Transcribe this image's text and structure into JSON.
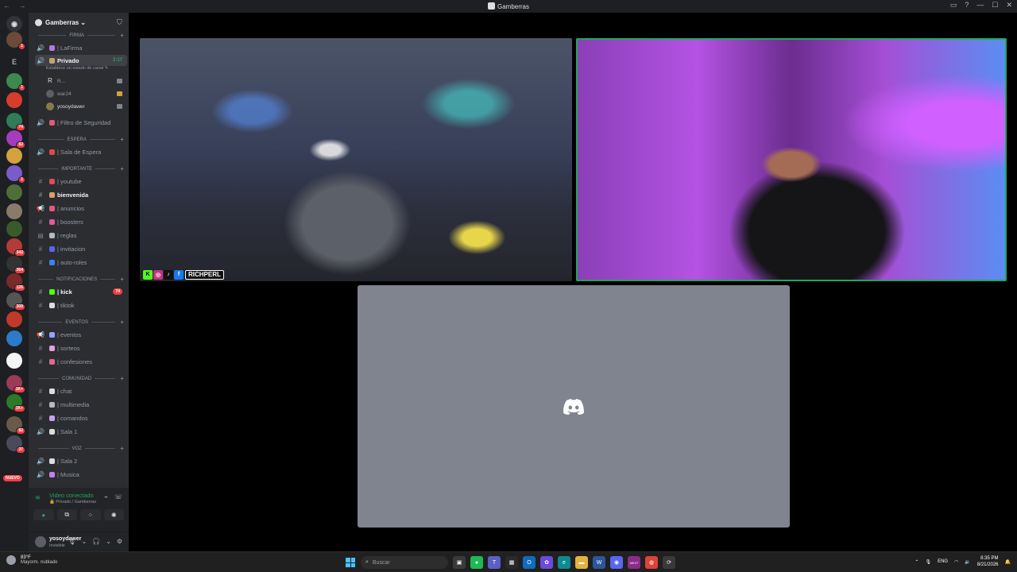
{
  "window": {
    "title": "Gamberras",
    "nav": "← →"
  },
  "window_controls": [
    "▭",
    "?",
    "—",
    "☐",
    "✕"
  ],
  "guilds": {
    "home_label": "◉",
    "letter": "E",
    "items": [
      {
        "color": "#6b4a3a",
        "badge": "1"
      },
      {
        "color": "#3c8a4f",
        "badge": "1"
      },
      {
        "color": "#d83c2e",
        "badge": ""
      },
      {
        "color": "#2f7d5a",
        "badge": "74"
      },
      {
        "color": "#a33dbd",
        "badge": "82"
      },
      {
        "color": "#d1a23e",
        "badge": ""
      },
      {
        "color": "#7a5cc8",
        "badge": "1"
      },
      {
        "color": "#4e6e3a",
        "badge": ""
      },
      {
        "color": "#8a7a6a",
        "badge": ""
      },
      {
        "color": "#3a5a2a",
        "badge": ""
      },
      {
        "color": "#b53a3a",
        "badge": "342"
      },
      {
        "color": "#333333",
        "badge": "364"
      },
      {
        "color": "#7a2a2a",
        "badge": "126"
      },
      {
        "color": "#555555",
        "badge": "309"
      },
      {
        "color": "#c0392b",
        "badge": ""
      },
      {
        "color": "#2c7ac9",
        "badge": ""
      },
      {
        "color": "#f5f5f5",
        "badge": ""
      },
      {
        "color": "#9c3a5a",
        "badge": "1K+"
      },
      {
        "color": "#2a7a2a",
        "badge": "1K+"
      },
      {
        "color": "#6a5a4a",
        "badge": "82"
      },
      {
        "color": "#4a4a5a",
        "badge": "37"
      }
    ],
    "nuevo_label": "NUEVO"
  },
  "server": {
    "name": "Gamberras",
    "chevron": "⌄"
  },
  "categories": [
    {
      "label": "FIRMA"
    },
    {
      "label": "ESPERA"
    },
    {
      "label": "IMPORTANTE"
    },
    {
      "label": "NOTIFICACIONES"
    },
    {
      "label": "EVENTOS"
    },
    {
      "label": "COMUNIDAD"
    },
    {
      "label": "VOZ"
    }
  ],
  "channels": [
    {
      "icon": "🔊",
      "label": "| LaFirma",
      "emo": "#b07ae0"
    },
    {
      "icon": "🔊",
      "label": "Privado",
      "emo": "#c9a26a",
      "timer": "2:17"
    },
    {
      "icon": "🔊",
      "label": "| Filtro de Seguridad",
      "emo": "#e05a7a"
    },
    {
      "icon": "🔊",
      "label": "| Sala de Espera",
      "emo": "#e04a4a"
    },
    {
      "icon": "#",
      "label": "| youtube",
      "emo": "#e04a5a"
    },
    {
      "icon": "#",
      "label": "bienvenida",
      "emo": "#d9a066"
    },
    {
      "icon": "📢",
      "label": "| anuncios",
      "emo": "#e05a7a"
    },
    {
      "icon": "#",
      "label": "| boosters",
      "emo": "#e05a9a"
    },
    {
      "icon": "▤",
      "label": "| reglas",
      "emo": "#b5bac1"
    },
    {
      "icon": "#",
      "label": "| invitacion",
      "emo": "#5865f2"
    },
    {
      "icon": "#",
      "label": "| auto-roles",
      "emo": "#3b82f6"
    },
    {
      "icon": "#",
      "label": "| kick",
      "emo": "#53fc18",
      "badge": "74"
    },
    {
      "icon": "#",
      "label": "| tiktok",
      "emo": "#dbdee1"
    },
    {
      "icon": "📢",
      "label": "| eventos",
      "emo": "#9aa0ff"
    },
    {
      "icon": "#",
      "label": "| sorteos",
      "emo": "#e0a0e0"
    },
    {
      "icon": "#",
      "label": "| confesiones",
      "emo": "#e06a8a"
    },
    {
      "icon": "#",
      "label": "| chat",
      "emo": "#dbdee1"
    },
    {
      "icon": "#",
      "label": "| multimedia",
      "emo": "#b5bac1"
    },
    {
      "icon": "#",
      "label": "| comandos",
      "emo": "#c8a0f0"
    },
    {
      "icon": "🔊",
      "label": "| Sala 1",
      "emo": "#dbdee1"
    },
    {
      "icon": "🔊",
      "label": "| Sala 2",
      "emo": "#dbdee1"
    },
    {
      "icon": "🔊",
      "label": "| Musica",
      "emo": "#c080f0"
    }
  ],
  "privado_status": "Establece un estado de canal ✎",
  "voice_users": [
    {
      "name": "R...",
      "color": "#2b2d31"
    },
    {
      "name": "war24",
      "color": "#5c5e66"
    },
    {
      "name": "yosoydawer",
      "color": "#8a7a4a"
    }
  ],
  "voice_panel": {
    "status": "Video conectado",
    "channel": "🔒 Privado / Gamberras",
    "buttons": [
      "●",
      "⧉",
      "⁘",
      "✺"
    ]
  },
  "user_panel": {
    "name": "yosoydawer",
    "status": "Invisible",
    "controls": [
      "🎙",
      "⌄",
      "🎧",
      "⌄",
      "⚙"
    ]
  },
  "streams": [
    {
      "label": "RICHPERL"
    },
    {
      "label": ""
    },
    {
      "label": ""
    }
  ],
  "stream_badges": [
    {
      "letter": "K",
      "color": "#53fc18"
    },
    {
      "letter": "◎",
      "color": "#c13584"
    },
    {
      "letter": "♪",
      "color": "#111111"
    },
    {
      "letter": "f",
      "color": "#1877f2"
    }
  ],
  "taskbar": {
    "weather_temp": "83°F",
    "weather_cond": "Mayorm. nublado",
    "search_placeholder": "Buscar",
    "apps": [
      {
        "label": "▣",
        "color": "#3a3a3a"
      },
      {
        "label": "●",
        "color": "#1db954"
      },
      {
        "label": "T",
        "color": "#5b5fc7"
      },
      {
        "label": "▦",
        "color": "#2a2a2a"
      },
      {
        "label": "O",
        "color": "#0f6cbd"
      },
      {
        "label": "✿",
        "color": "#6a4ad9"
      },
      {
        "label": "e",
        "color": "#0c8a8f"
      },
      {
        "label": "▬",
        "color": "#e3b341"
      },
      {
        "label": "W",
        "color": "#2b579a"
      },
      {
        "label": "◉",
        "color": "#5865f2"
      },
      {
        "label": "NEXT",
        "color": "#8b2b8b"
      },
      {
        "label": "◍",
        "color": "#db4437"
      },
      {
        "label": "⟳",
        "color": "#3a3a3a"
      }
    ],
    "lang": "ENG",
    "time": "8:35 PM",
    "date": "8/21/2026"
  }
}
